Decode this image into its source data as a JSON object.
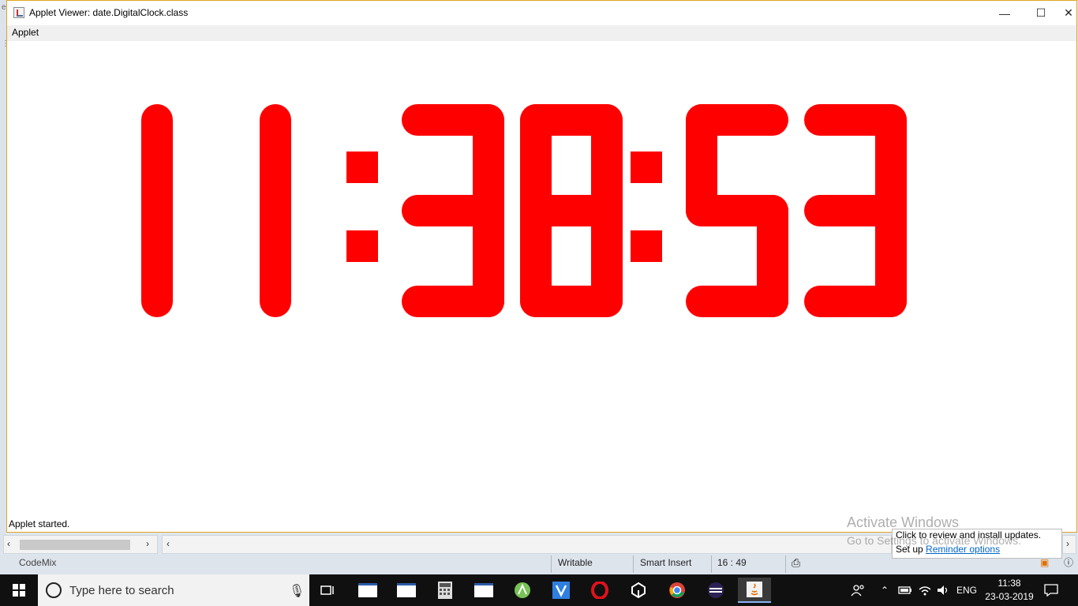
{
  "window": {
    "title": "Applet Viewer: date.DigitalClock.class",
    "minimize": "—",
    "maximize": "☐",
    "close": "✕"
  },
  "menu": {
    "applet": "Applet"
  },
  "clock": {
    "time": "11:38:53",
    "color": "#ff0000"
  },
  "status": "Applet started.",
  "ide": {
    "codemix": "CodeMix",
    "writable": "Writable",
    "insert_mode": "Smart Insert",
    "position": "16 : 49"
  },
  "notification": {
    "line1": "Click to review and install updates.",
    "line2_prefix": "Set up ",
    "link": "Reminder options"
  },
  "watermark": {
    "line1": "Activate Windows",
    "line2": "Go to Settings to activate Windows."
  },
  "taskbar": {
    "search_placeholder": "Type here to search",
    "time": "11:38",
    "date": "23-03-2019",
    "language": "ENG"
  }
}
